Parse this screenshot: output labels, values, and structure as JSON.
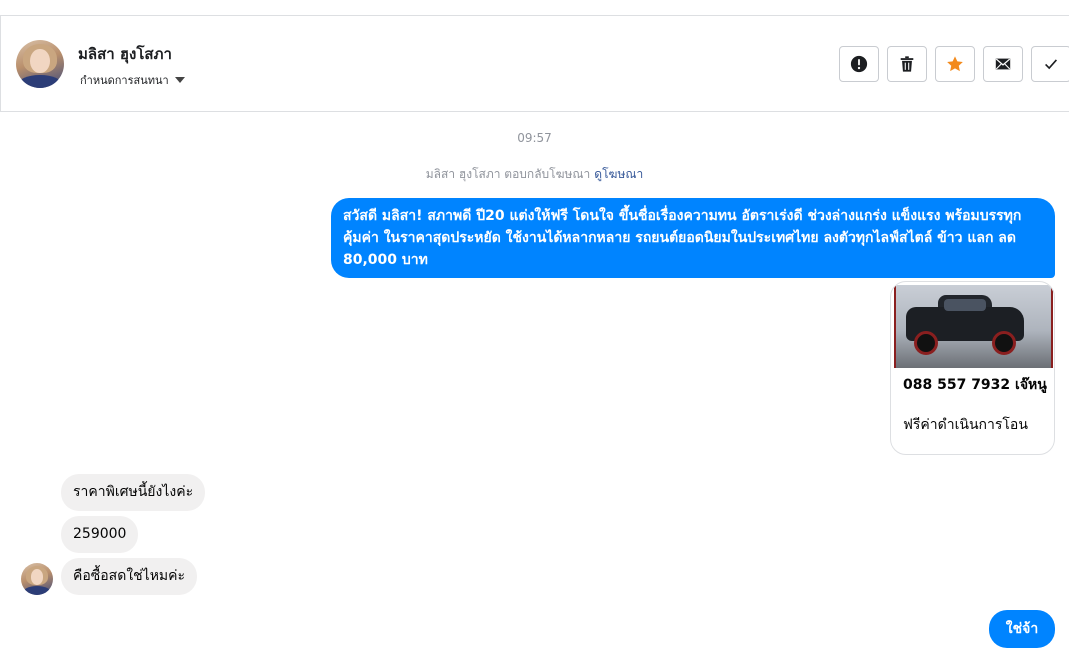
{
  "contact": {
    "name": "มลิสา ฮุงโสภา",
    "conversation_setting": "กำหนดการสนทนา"
  },
  "actions": [
    {
      "name": "spam",
      "icon": "exclamation-icon"
    },
    {
      "name": "delete",
      "icon": "trash-icon"
    },
    {
      "name": "star",
      "icon": "star-icon",
      "color": "#f38a1c"
    },
    {
      "name": "mark-unread",
      "icon": "envelope-icon"
    },
    {
      "name": "done",
      "icon": "check-icon"
    }
  ],
  "conversation": {
    "time": "09:57",
    "reply_note": "มลิสา ฮุงโสภา ตอบกลับโฆษณา",
    "reply_link": "ดูโฆษณา",
    "messages": {
      "main": "สวัสดี มลิสา! สภาพดี ปี20 แต่งให้ฟรี โดนใจ ขึ้นชื่อเรื่องความทน อัตราเร่งดี ช่วงล่างแกร่ง แข็งแรง พร้อมบรรทุก คุ้มค่า ในราคาสุดประหยัด ใช้งานได้หลากหลาย รถยนต์ยอดนิยมในประเทศไทย ลงตัวทุกไลฟ์สไตล์ ข้าว แลก ลด 80,000 บาท",
      "card_title": "088 557 7932 เจ๊หนู",
      "card_desc": "ฟรีค่าดำเนินการโอน",
      "in1": "ราคาพิเศษนี้ยังไงค่ะ",
      "in2": "259000",
      "in3": "คือซื้อสดใช่ไหมค่ะ",
      "final": "ใช่จ้า"
    }
  },
  "colors": {
    "outgoing_bubble": "#0084ff",
    "incoming_bubble": "#f1f0f0",
    "link": "#365899"
  }
}
